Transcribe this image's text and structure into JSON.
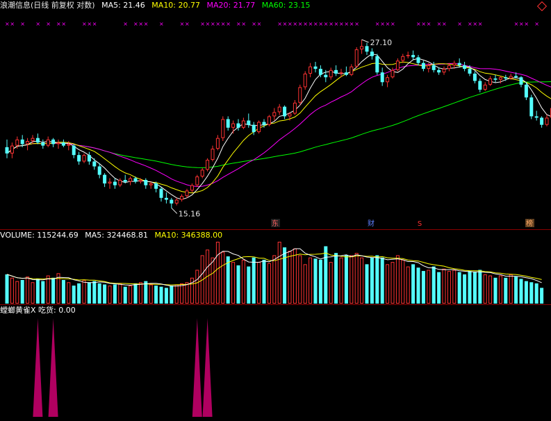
{
  "price_panel": {
    "title": "浪潮信息(日线 前复权 对数)",
    "legend": [
      {
        "label": "MA5: 21.46",
        "color": "#ffffff"
      },
      {
        "label": "MA10: 20.77",
        "color": "#ffff00"
      },
      {
        "label": "MA20: 21.77",
        "color": "#ff00ff"
      },
      {
        "label": "MA60: 23.15",
        "color": "#00ff00"
      }
    ],
    "high_label": "27.10",
    "low_label": "15.16",
    "event_markers": [
      "东",
      "财",
      "S",
      "榜"
    ]
  },
  "volume_panel": {
    "legend": [
      {
        "label": "VOLUME: 115244.69",
        "color": "#ffffff"
      },
      {
        "label": "MA5: 324468.81",
        "color": "#ffffff"
      },
      {
        "label": "MA10: 346388.00",
        "color": "#ffff00"
      }
    ]
  },
  "indicator_panel": {
    "legend": [
      {
        "label": "螳螂黄雀X 吃货: 0.00",
        "color": "#ffffff"
      }
    ]
  },
  "colors": {
    "up": "#ff3232",
    "down": "#54ffff",
    "ma5": "#ffffff",
    "ma10": "#ffff00",
    "ma20": "#ff00ff",
    "ma60": "#00ff00",
    "signal": "#b00060",
    "marker": "#ff00ff"
  },
  "chart_data": {
    "type": "candlestick",
    "y_scale": "log",
    "price_range": [
      14.5,
      28.5
    ],
    "candles": [
      {
        "o": 18.7,
        "h": 19.2,
        "l": 18.0,
        "c": 18.3
      },
      {
        "o": 18.3,
        "h": 19.0,
        "l": 18.0,
        "c": 18.8
      },
      {
        "o": 18.8,
        "h": 19.4,
        "l": 18.6,
        "c": 19.2
      },
      {
        "o": 19.2,
        "h": 19.5,
        "l": 18.7,
        "c": 18.9
      },
      {
        "o": 18.9,
        "h": 19.3,
        "l": 18.5,
        "c": 19.1
      },
      {
        "o": 19.1,
        "h": 19.5,
        "l": 18.9,
        "c": 19.3
      },
      {
        "o": 19.3,
        "h": 19.6,
        "l": 18.9,
        "c": 19.0
      },
      {
        "o": 19.0,
        "h": 19.2,
        "l": 18.6,
        "c": 18.8
      },
      {
        "o": 18.8,
        "h": 19.4,
        "l": 18.7,
        "c": 19.2
      },
      {
        "o": 19.2,
        "h": 19.3,
        "l": 18.7,
        "c": 18.9
      },
      {
        "o": 18.9,
        "h": 19.2,
        "l": 18.6,
        "c": 19.0
      },
      {
        "o": 19.0,
        "h": 19.2,
        "l": 18.7,
        "c": 18.8
      },
      {
        "o": 18.8,
        "h": 19.1,
        "l": 18.5,
        "c": 18.9
      },
      {
        "o": 18.8,
        "h": 18.9,
        "l": 18.0,
        "c": 18.2
      },
      {
        "o": 18.2,
        "h": 18.4,
        "l": 17.6,
        "c": 17.8
      },
      {
        "o": 17.8,
        "h": 18.3,
        "l": 17.7,
        "c": 18.2
      },
      {
        "o": 18.2,
        "h": 18.4,
        "l": 17.6,
        "c": 17.8
      },
      {
        "o": 17.8,
        "h": 18.0,
        "l": 17.3,
        "c": 17.5
      },
      {
        "o": 17.5,
        "h": 17.7,
        "l": 16.8,
        "c": 17.0
      },
      {
        "o": 17.0,
        "h": 17.1,
        "l": 16.3,
        "c": 16.5
      },
      {
        "o": 16.5,
        "h": 16.8,
        "l": 16.2,
        "c": 16.6
      },
      {
        "o": 16.6,
        "h": 16.8,
        "l": 16.2,
        "c": 16.4
      },
      {
        "o": 16.4,
        "h": 16.8,
        "l": 16.3,
        "c": 16.7
      },
      {
        "o": 16.7,
        "h": 17.0,
        "l": 16.5,
        "c": 16.6
      },
      {
        "o": 16.6,
        "h": 16.9,
        "l": 16.4,
        "c": 16.8
      },
      {
        "o": 16.8,
        "h": 16.9,
        "l": 16.5,
        "c": 16.6
      },
      {
        "o": 16.6,
        "h": 16.8,
        "l": 16.5,
        "c": 16.7
      },
      {
        "o": 16.7,
        "h": 16.8,
        "l": 16.2,
        "c": 16.4
      },
      {
        "o": 16.4,
        "h": 16.6,
        "l": 16.2,
        "c": 16.5
      },
      {
        "o": 16.5,
        "h": 16.6,
        "l": 16.0,
        "c": 16.2
      },
      {
        "o": 16.2,
        "h": 16.3,
        "l": 15.5,
        "c": 15.7
      },
      {
        "o": 15.7,
        "h": 16.0,
        "l": 15.4,
        "c": 15.6
      },
      {
        "o": 15.6,
        "h": 15.7,
        "l": 15.16,
        "c": 15.4
      },
      {
        "o": 15.4,
        "h": 15.7,
        "l": 15.3,
        "c": 15.6
      },
      {
        "o": 15.6,
        "h": 15.9,
        "l": 15.5,
        "c": 15.8
      },
      {
        "o": 15.8,
        "h": 16.2,
        "l": 15.7,
        "c": 16.1
      },
      {
        "o": 16.1,
        "h": 16.5,
        "l": 16.0,
        "c": 16.4
      },
      {
        "o": 16.4,
        "h": 17.0,
        "l": 16.3,
        "c": 16.9
      },
      {
        "o": 16.9,
        "h": 17.4,
        "l": 16.8,
        "c": 17.3
      },
      {
        "o": 17.3,
        "h": 18.0,
        "l": 17.2,
        "c": 17.9
      },
      {
        "o": 17.9,
        "h": 18.8,
        "l": 17.8,
        "c": 18.6
      },
      {
        "o": 18.6,
        "h": 19.5,
        "l": 18.5,
        "c": 19.3
      },
      {
        "o": 19.3,
        "h": 20.8,
        "l": 19.1,
        "c": 20.6
      },
      {
        "o": 20.6,
        "h": 20.8,
        "l": 19.8,
        "c": 20.0
      },
      {
        "o": 20.0,
        "h": 20.5,
        "l": 19.6,
        "c": 20.3
      },
      {
        "o": 20.3,
        "h": 20.6,
        "l": 19.8,
        "c": 20.0
      },
      {
        "o": 20.0,
        "h": 20.7,
        "l": 19.9,
        "c": 20.5
      },
      {
        "o": 20.5,
        "h": 21.0,
        "l": 20.0,
        "c": 20.2
      },
      {
        "o": 20.2,
        "h": 20.4,
        "l": 19.5,
        "c": 19.7
      },
      {
        "o": 19.7,
        "h": 20.5,
        "l": 19.6,
        "c": 20.4
      },
      {
        "o": 20.4,
        "h": 20.6,
        "l": 20.0,
        "c": 20.2
      },
      {
        "o": 20.2,
        "h": 20.9,
        "l": 20.1,
        "c": 20.8
      },
      {
        "o": 20.8,
        "h": 21.4,
        "l": 20.5,
        "c": 21.1
      },
      {
        "o": 21.1,
        "h": 21.7,
        "l": 20.9,
        "c": 21.5
      },
      {
        "o": 21.5,
        "h": 21.6,
        "l": 20.6,
        "c": 20.8
      },
      {
        "o": 20.8,
        "h": 21.1,
        "l": 20.5,
        "c": 21.0
      },
      {
        "o": 21.0,
        "h": 22.0,
        "l": 20.9,
        "c": 21.8
      },
      {
        "o": 21.8,
        "h": 23.2,
        "l": 21.6,
        "c": 23.0
      },
      {
        "o": 23.0,
        "h": 24.3,
        "l": 22.8,
        "c": 24.1
      },
      {
        "o": 24.1,
        "h": 25.0,
        "l": 23.8,
        "c": 24.7
      },
      {
        "o": 24.7,
        "h": 25.1,
        "l": 24.2,
        "c": 24.5
      },
      {
        "o": 24.5,
        "h": 24.8,
        "l": 23.8,
        "c": 24.0
      },
      {
        "o": 24.0,
        "h": 24.4,
        "l": 23.4,
        "c": 23.8
      },
      {
        "o": 23.8,
        "h": 24.6,
        "l": 23.6,
        "c": 24.4
      },
      {
        "o": 24.4,
        "h": 24.8,
        "l": 23.9,
        "c": 24.1
      },
      {
        "o": 24.1,
        "h": 24.5,
        "l": 23.8,
        "c": 24.2
      },
      {
        "o": 24.2,
        "h": 24.7,
        "l": 23.9,
        "c": 24.0
      },
      {
        "o": 24.0,
        "h": 24.9,
        "l": 23.9,
        "c": 24.7
      },
      {
        "o": 24.7,
        "h": 26.4,
        "l": 24.6,
        "c": 26.2
      },
      {
        "o": 26.2,
        "h": 27.1,
        "l": 25.8,
        "c": 26.5
      },
      {
        "o": 26.5,
        "h": 26.8,
        "l": 25.7,
        "c": 26.0
      },
      {
        "o": 26.0,
        "h": 26.3,
        "l": 25.3,
        "c": 25.6
      },
      {
        "o": 25.6,
        "h": 25.8,
        "l": 24.0,
        "c": 24.2
      },
      {
        "o": 24.2,
        "h": 24.6,
        "l": 23.1,
        "c": 23.4
      },
      {
        "o": 23.4,
        "h": 24.0,
        "l": 23.0,
        "c": 23.8
      },
      {
        "o": 23.8,
        "h": 24.6,
        "l": 23.7,
        "c": 24.4
      },
      {
        "o": 24.4,
        "h": 25.4,
        "l": 24.3,
        "c": 25.2
      },
      {
        "o": 25.2,
        "h": 25.8,
        "l": 25.0,
        "c": 25.6
      },
      {
        "o": 25.6,
        "h": 26.0,
        "l": 25.4,
        "c": 25.7
      },
      {
        "o": 25.7,
        "h": 26.1,
        "l": 25.3,
        "c": 25.5
      },
      {
        "o": 25.5,
        "h": 25.7,
        "l": 24.8,
        "c": 25.0
      },
      {
        "o": 25.0,
        "h": 25.2,
        "l": 24.3,
        "c": 24.5
      },
      {
        "o": 24.5,
        "h": 25.0,
        "l": 24.2,
        "c": 24.8
      },
      {
        "o": 24.8,
        "h": 25.1,
        "l": 24.2,
        "c": 24.4
      },
      {
        "o": 24.4,
        "h": 24.6,
        "l": 24.0,
        "c": 24.2
      },
      {
        "o": 24.2,
        "h": 24.7,
        "l": 24.0,
        "c": 24.5
      },
      {
        "o": 24.5,
        "h": 25.0,
        "l": 24.3,
        "c": 24.8
      },
      {
        "o": 24.8,
        "h": 25.2,
        "l": 24.5,
        "c": 25.0
      },
      {
        "o": 25.0,
        "h": 25.4,
        "l": 24.6,
        "c": 24.8
      },
      {
        "o": 24.8,
        "h": 25.1,
        "l": 24.3,
        "c": 24.5
      },
      {
        "o": 24.5,
        "h": 24.8,
        "l": 23.9,
        "c": 24.1
      },
      {
        "o": 24.1,
        "h": 24.3,
        "l": 23.3,
        "c": 23.5
      },
      {
        "o": 23.5,
        "h": 23.7,
        "l": 22.6,
        "c": 22.8
      },
      {
        "o": 22.8,
        "h": 23.4,
        "l": 22.7,
        "c": 23.2
      },
      {
        "o": 23.2,
        "h": 23.9,
        "l": 23.1,
        "c": 23.7
      },
      {
        "o": 23.7,
        "h": 24.0,
        "l": 23.4,
        "c": 23.6
      },
      {
        "o": 23.6,
        "h": 23.9,
        "l": 23.3,
        "c": 23.8
      },
      {
        "o": 23.8,
        "h": 24.0,
        "l": 23.5,
        "c": 23.7
      },
      {
        "o": 23.7,
        "h": 24.1,
        "l": 23.6,
        "c": 23.9
      },
      {
        "o": 23.9,
        "h": 24.2,
        "l": 23.7,
        "c": 23.8
      },
      {
        "o": 23.8,
        "h": 23.9,
        "l": 23.0,
        "c": 23.2
      },
      {
        "o": 23.2,
        "h": 23.4,
        "l": 22.0,
        "c": 22.2
      },
      {
        "o": 22.2,
        "h": 22.4,
        "l": 20.6,
        "c": 20.8
      },
      {
        "o": 20.8,
        "h": 21.2,
        "l": 20.5,
        "c": 20.7
      },
      {
        "o": 20.7,
        "h": 20.8,
        "l": 20.0,
        "c": 20.2
      },
      {
        "o": 20.2,
        "h": 20.9,
        "l": 20.1,
        "c": 20.7
      },
      {
        "o": 20.7,
        "h": 21.6,
        "l": 20.6,
        "c": 21.4
      },
      {
        "o": 21.4,
        "h": 22.1,
        "l": 21.2,
        "c": 21.9
      }
    ],
    "volume": [
      130,
      115,
      100,
      105,
      120,
      95,
      110,
      100,
      125,
      115,
      135,
      105,
      95,
      80,
      90,
      105,
      95,
      100,
      90,
      85,
      80,
      85,
      90,
      75,
      80,
      90,
      95,
      100,
      85,
      80,
      75,
      70,
      80,
      85,
      90,
      95,
      115,
      150,
      215,
      240,
      205,
      275,
      230,
      210,
      185,
      170,
      195,
      165,
      205,
      185,
      195,
      180,
      215,
      275,
      250,
      235,
      245,
      215,
      175,
      205,
      200,
      195,
      255,
      185,
      225,
      205,
      215,
      215,
      225,
      205,
      175,
      205,
      215,
      205,
      175,
      185,
      215,
      195,
      165,
      175,
      160,
      145,
      150,
      165,
      140,
      155,
      145,
      150,
      140,
      130,
      145,
      140,
      150,
      130,
      125,
      115,
      125,
      115,
      130,
      120,
      110,
      100,
      95,
      90,
      70
    ],
    "signal_bars": [
      {
        "index": 6,
        "value": 1
      },
      {
        "index": 9,
        "value": 1
      },
      {
        "index": 37,
        "value": 1
      },
      {
        "index": 39,
        "value": 1
      }
    ]
  }
}
